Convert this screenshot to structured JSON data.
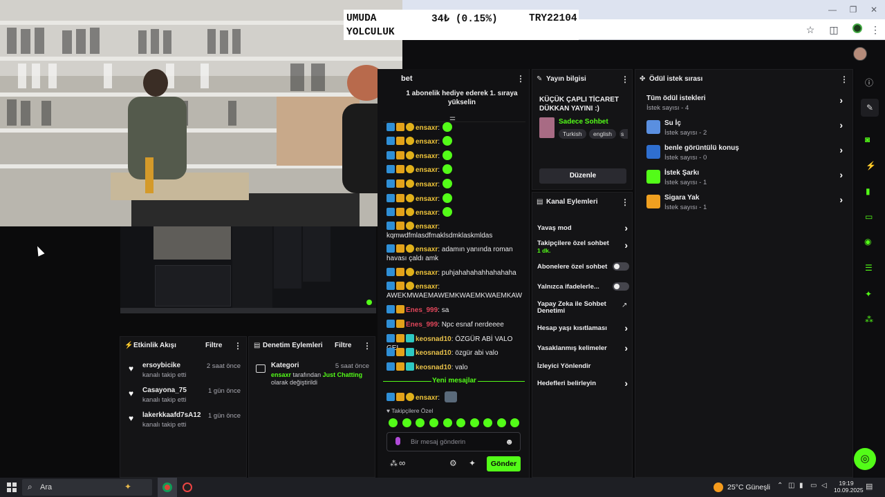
{
  "ticker": {
    "name_line1": "UMUDA",
    "name_line2": "YOLCULUK",
    "change": "34₺ (0.15%)",
    "price": "TRY22104"
  },
  "chat": {
    "title": "bet",
    "pinned": "1 abonelik hediye ederek 1. sıraya yükselin",
    "messages": [
      {
        "user": "ensaxr",
        "text": ":",
        "style": "ens",
        "emote": true
      },
      {
        "user": "ensaxr",
        "text": ":",
        "style": "ens",
        "emote": true
      },
      {
        "user": "ensaxr",
        "text": ":",
        "style": "ens",
        "emote": true
      },
      {
        "user": "ensaxr",
        "text": ":",
        "style": "ens",
        "emote": true
      },
      {
        "user": "ensaxr",
        "text": ":",
        "style": "ens",
        "emote": true
      },
      {
        "user": "ensaxr",
        "text": ":",
        "style": "ens",
        "emote": true
      },
      {
        "user": "ensaxr",
        "text": ":",
        "style": "ens",
        "emote": true
      },
      {
        "user": "ensaxr",
        "text": ":",
        "style": "ens",
        "emote": false
      },
      {
        "user": "",
        "text": "kqmwdfmlasdfmaklsdmklaskmldas",
        "style": "cont",
        "emote": false
      },
      {
        "user": "ensaxr",
        "text": ": adamın yanında roman",
        "style": "ens",
        "emote": false
      },
      {
        "user": "",
        "text": "havası çaldı amk",
        "style": "cont",
        "emote": false
      },
      {
        "user": "ensaxr",
        "text": ": puhjahahahahhahahaha",
        "style": "ens",
        "emote": false
      },
      {
        "user": "ensaxr",
        "text": ":",
        "style": "ens",
        "emote": false
      },
      {
        "user": "",
        "text": "AWEKMWAEMAWEMKWAEMKWAEMKAW",
        "style": "cont",
        "emote": false
      },
      {
        "user": "Enes_999",
        "text": ": sa",
        "style": "red",
        "emote": false
      },
      {
        "user": "Enes_999",
        "text": ": Npc esnaf nerdeeee",
        "style": "red",
        "emote": false
      },
      {
        "user": "keosnad10",
        "text": ": ÖZGÜR ABİ VALO GEL",
        "style": "keo",
        "emote": false
      },
      {
        "user": "keosnad10",
        "text": ": özgür abi valo",
        "style": "keo",
        "emote": false
      },
      {
        "user": "keosnad10",
        "text": ": valo",
        "style": "keo",
        "emote": false
      }
    ],
    "new_messages": "Yeni mesajlar",
    "last_message_user": "ensaxr",
    "last_message_text": ":",
    "followers_only": "Takipçilere Özel",
    "input_placeholder": "Bir mesaj gönderin",
    "infinity": "∞",
    "send_label": "Gönder"
  },
  "stream_info": {
    "title": "Yayın bilgisi",
    "stream_title": "KÜÇÜK ÇAPLI TİCARET DÜKKAN YAYINI :)",
    "category": "Sadece Sohbet",
    "tags": [
      "Turkish",
      "english",
      "s"
    ],
    "edit_label": "Düzenle"
  },
  "channel_actions": {
    "title": "Kanal Eylemleri",
    "items": [
      {
        "label": "Yavaş mod",
        "sub": "",
        "control": "chevron"
      },
      {
        "label": "Takipçilere özel sohbet",
        "sub": "1 dk.",
        "control": "chevron"
      },
      {
        "label": "Abonelere özel sohbet",
        "sub": "",
        "control": "toggle"
      },
      {
        "label": "Yalnızca ifadelerle...",
        "sub": "",
        "control": "toggle"
      },
      {
        "label": "Yapay Zeka ile Sohbet Denetimi",
        "sub": "",
        "control": "external"
      },
      {
        "label": "Hesap yaşı kısıtlaması",
        "sub": "",
        "control": "chevron"
      },
      {
        "label": "Yasaklanmış kelimeler",
        "sub": "",
        "control": "chevron"
      },
      {
        "label": "İzleyici Yönlendir",
        "sub": "",
        "control": "none"
      },
      {
        "label": "Hedefleri belirleyin",
        "sub": "",
        "control": "chevron"
      }
    ]
  },
  "rewards": {
    "title": "Ödül istek sırası",
    "all_label": "Tüm ödül istekleri",
    "all_count": "İstek sayısı - 4",
    "items": [
      {
        "name": "Su İç",
        "count": "İstek sayısı - 2",
        "color": "#5a8fe0"
      },
      {
        "name": "benle görüntülü konuş",
        "count": "İstek sayısı - 0",
        "color": "#2f6fd0"
      },
      {
        "name": "İstek Şarkı",
        "count": "İstek sayısı - 1",
        "color": "#53fc18"
      },
      {
        "name": "Sigara Yak",
        "count": "İstek sayısı - 1",
        "color": "#f0a020"
      }
    ]
  },
  "activity": {
    "title": "Etkinlik Akışı",
    "filter": "Filtre",
    "items": [
      {
        "user": "ersoybicike",
        "action": "kanalı takip etti",
        "time": "2 saat önce"
      },
      {
        "user": "Casayona_75",
        "action": "kanalı takip etti",
        "time": "1 gün önce"
      },
      {
        "user": "lakerkkaafd7sA12",
        "action": "kanalı takip etti",
        "time": "1 gün önce"
      }
    ]
  },
  "moderation": {
    "title": "Denetim Eylemleri",
    "filter": "Filtre",
    "item_title": "Kategori",
    "item_time": "5 saat önce",
    "item_user": "ensaxr",
    "item_mid": "tarafından",
    "item_cat": "Just Chatting",
    "item_end": "olarak değiştirildi"
  },
  "taskbar": {
    "search": "Ara",
    "weather": "25°C Güneşli",
    "time": "19:19",
    "date": "10.09.2025"
  },
  "colors": {
    "accent": "#53fc18",
    "panel": "#141416"
  }
}
